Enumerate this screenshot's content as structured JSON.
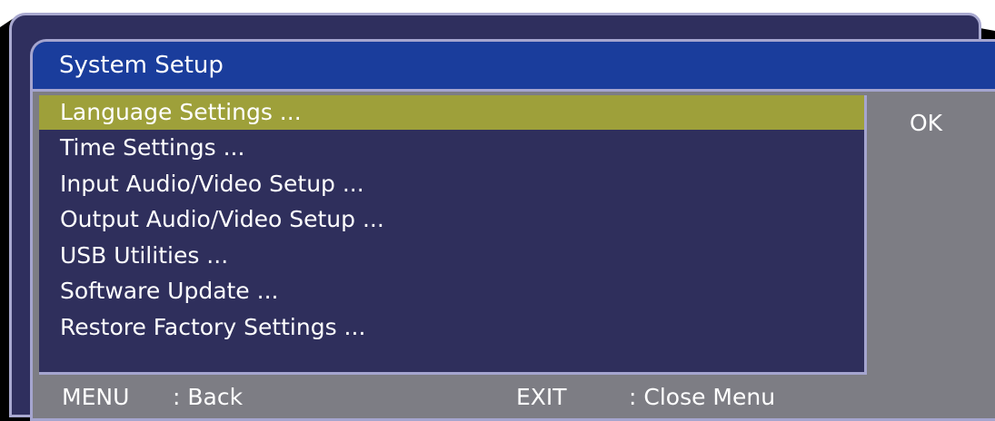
{
  "dialog": {
    "title": "System Setup",
    "confirm_label": "OK"
  },
  "menu": {
    "selected_index": 0,
    "items": [
      {
        "label": "Language Settings ..."
      },
      {
        "label": "Time Settings ..."
      },
      {
        "label": "Input Audio/Video Setup ..."
      },
      {
        "label": "Output Audio/Video Setup ..."
      },
      {
        "label": "USB Utilities ..."
      },
      {
        "label": "Software Update ..."
      },
      {
        "label": "Restore Factory Settings ..."
      }
    ]
  },
  "footer": {
    "menu_key": "MENU",
    "menu_action": ": Back",
    "exit_key": "EXIT",
    "exit_action": ": Close Menu"
  },
  "colors": {
    "title_bar": "#1a3d9c",
    "menu_background": "#2f2f5c",
    "selection_highlight": "#9ea03a",
    "dialog_background": "#7d7d84",
    "border": "#a5a5cf"
  }
}
